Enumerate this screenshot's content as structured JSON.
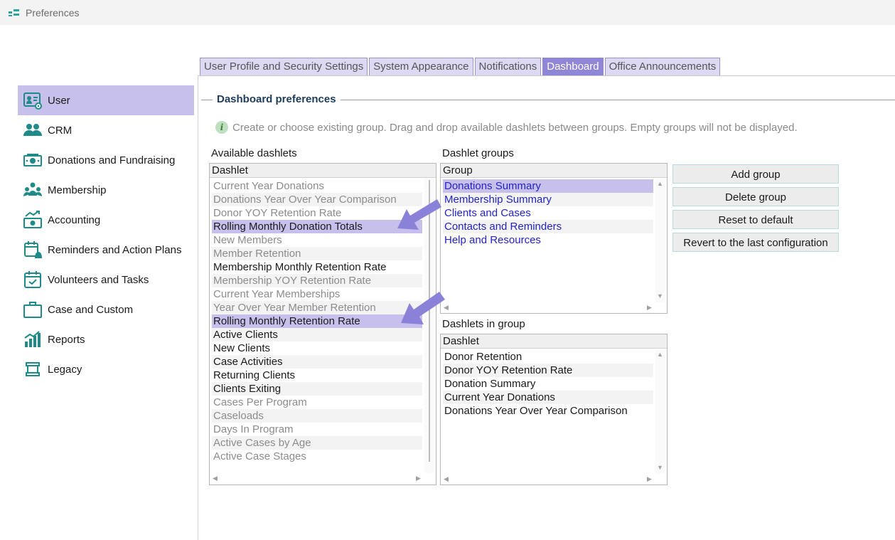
{
  "window": {
    "title": "Preferences"
  },
  "sidebar": {
    "items": [
      {
        "label": "User",
        "icon": "user-card-icon",
        "active": true
      },
      {
        "label": "CRM",
        "icon": "people-icon"
      },
      {
        "label": "Donations and Fundraising",
        "icon": "money-icon"
      },
      {
        "label": "Membership",
        "icon": "group-icon"
      },
      {
        "label": "Accounting",
        "icon": "accounting-icon"
      },
      {
        "label": "Reminders and Action Plans",
        "icon": "calendar-bell-icon"
      },
      {
        "label": "Volunteers and Tasks",
        "icon": "calendar-check-icon"
      },
      {
        "label": "Case and Custom",
        "icon": "briefcase-icon"
      },
      {
        "label": "Reports",
        "icon": "bar-chart-icon"
      },
      {
        "label": "Legacy",
        "icon": "scroll-icon"
      }
    ]
  },
  "tabs": [
    {
      "label": "User Profile and Security Settings"
    },
    {
      "label": "System Appearance"
    },
    {
      "label": "Notifications"
    },
    {
      "label": "Dashboard",
      "active": true
    },
    {
      "label": "Office Announcements"
    }
  ],
  "panel": {
    "title": "Dashboard preferences",
    "info": "Create or choose existing group. Drag and drop available dashlets between groups. Empty groups will not be displayed."
  },
  "available": {
    "label": "Available dashlets",
    "header": "Dashlet",
    "rows": [
      {
        "text": "Current Year Donations",
        "dim": true
      },
      {
        "text": "Donations Year Over Year Comparison",
        "dim": true
      },
      {
        "text": "Donor YOY Retention Rate",
        "dim": true
      },
      {
        "text": "Rolling Monthly Donation Totals",
        "sel": true
      },
      {
        "text": "New Members",
        "dim": true
      },
      {
        "text": "Member Retention",
        "dim": true
      },
      {
        "text": "Membership Monthly Retention Rate"
      },
      {
        "text": "Membership YOY Retention Rate",
        "dim": true
      },
      {
        "text": "Current Year Memberships",
        "dim": true
      },
      {
        "text": "Year Over Year Member Retention",
        "dim": true
      },
      {
        "text": "Rolling Monthly Retention Rate",
        "sel": true
      },
      {
        "text": "Active Clients"
      },
      {
        "text": "New Clients"
      },
      {
        "text": "Case Activities"
      },
      {
        "text": "Returning Clients"
      },
      {
        "text": "Clients Exiting"
      },
      {
        "text": "Cases Per Program",
        "dim": true
      },
      {
        "text": "Caseloads",
        "dim": true
      },
      {
        "text": "Days In Program",
        "dim": true
      },
      {
        "text": "Active Cases by Age",
        "dim": true
      },
      {
        "text": "Active Case Stages",
        "dim": true
      }
    ]
  },
  "groups": {
    "label": "Dashlet groups",
    "header": "Group",
    "rows": [
      {
        "text": "Donations Summary",
        "sel": true
      },
      {
        "text": "Membership Summary"
      },
      {
        "text": "Clients and Cases"
      },
      {
        "text": "Contacts and Reminders"
      },
      {
        "text": "Help and Resources"
      }
    ]
  },
  "in_group": {
    "label": "Dashlets in group",
    "header": "Dashlet",
    "rows": [
      {
        "text": "Donor Retention"
      },
      {
        "text": "Donor YOY Retention Rate"
      },
      {
        "text": "Donation Summary"
      },
      {
        "text": "Current Year Donations"
      },
      {
        "text": "Donations Year Over Year Comparison"
      }
    ]
  },
  "buttons": {
    "add": "Add group",
    "delete": "Delete group",
    "reset": "Reset to default",
    "revert": "Revert to the last configuration"
  },
  "colors": {
    "accent": "#8f86d8",
    "selection": "#c8c0ec",
    "link": "#2323c8",
    "icon_teal": "#1f8a8a",
    "callout_arrow": "#8a82d8"
  }
}
